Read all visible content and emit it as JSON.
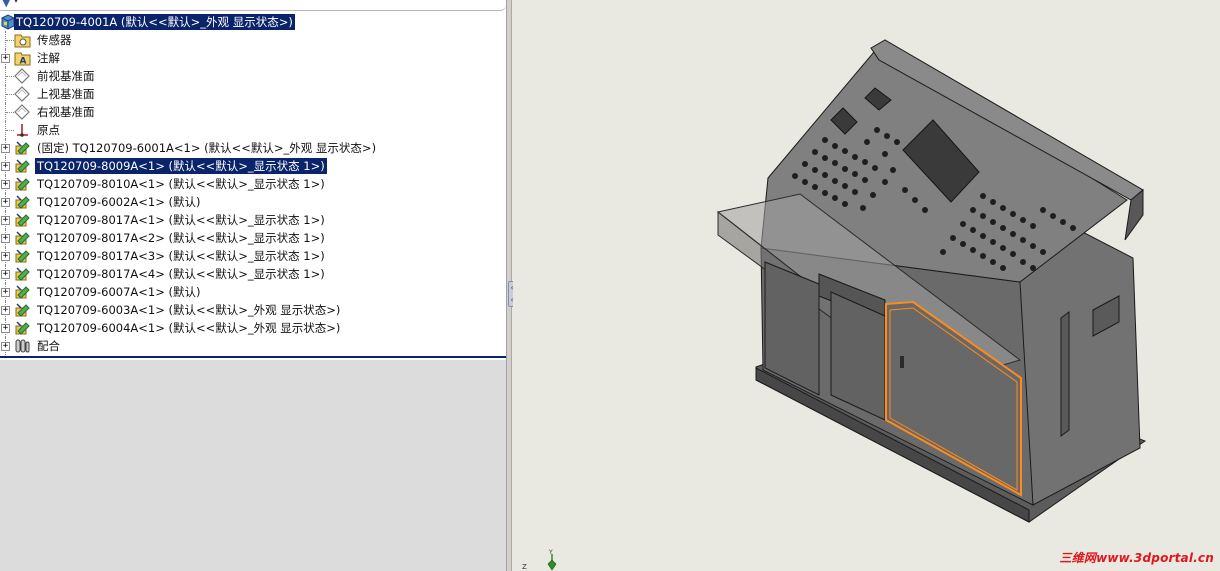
{
  "filter": {
    "icon": "filter-icon"
  },
  "tree": {
    "root": {
      "label": "TQ120709-4001A (默认<<默认>_外观 显示状态>)",
      "icon": "assembly-icon"
    },
    "items": [
      {
        "label": "传感器",
        "icon": "sensor-folder-icon",
        "expandable": false
      },
      {
        "label": "注解",
        "icon": "annotation-icon",
        "expandable": true
      },
      {
        "label": "前视基准面",
        "icon": "plane-icon",
        "expandable": false
      },
      {
        "label": "上视基准面",
        "icon": "plane-icon",
        "expandable": false
      },
      {
        "label": "右视基准面",
        "icon": "plane-icon",
        "expandable": false
      },
      {
        "label": "原点",
        "icon": "origin-icon",
        "expandable": false
      },
      {
        "label": "(固定) TQ120709-6001A<1> (默认<<默认>_外观 显示状态>)",
        "icon": "part-icon",
        "expandable": true
      },
      {
        "label": "TQ120709-8009A<1> (默认<<默认>_显示状态 1>)",
        "icon": "part-icon",
        "expandable": true,
        "selected": true
      },
      {
        "label": "TQ120709-8010A<1> (默认<<默认>_显示状态 1>)",
        "icon": "part-icon",
        "expandable": true
      },
      {
        "label": "TQ120709-6002A<1> (默认)",
        "icon": "part-icon",
        "expandable": true
      },
      {
        "label": "TQ120709-8017A<1> (默认<<默认>_显示状态 1>)",
        "icon": "part-icon",
        "expandable": true
      },
      {
        "label": "TQ120709-8017A<2> (默认<<默认>_显示状态 1>)",
        "icon": "part-icon",
        "expandable": true
      },
      {
        "label": "TQ120709-8017A<3> (默认<<默认>_显示状态 1>)",
        "icon": "part-icon",
        "expandable": true
      },
      {
        "label": "TQ120709-8017A<4> (默认<<默认>_显示状态 1>)",
        "icon": "part-icon",
        "expandable": true
      },
      {
        "label": "TQ120709-6007A<1> (默认)",
        "icon": "part-icon",
        "expandable": true
      },
      {
        "label": "TQ120709-6003A<1> (默认<<默认>_外观 显示状态>)",
        "icon": "part-icon",
        "expandable": true
      },
      {
        "label": "TQ120709-6004A<1> (默认<<默认>_外观 显示状态>)",
        "icon": "part-icon",
        "expandable": true
      },
      {
        "label": "配合",
        "icon": "mates-icon",
        "expandable": true
      }
    ]
  },
  "viewport": {
    "triad": {
      "y_label": "Y",
      "z_label": "Z"
    },
    "watermark": "三维网www.3dportal.cn",
    "colors": {
      "background": "#eae9e1",
      "body": "#6e6e6e",
      "highlight": "#ff8c1a",
      "selection": "#0a246a"
    }
  }
}
